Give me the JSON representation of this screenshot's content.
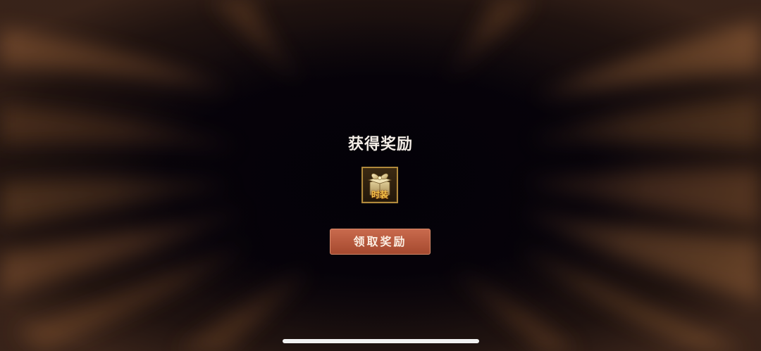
{
  "reward_popup": {
    "title": "获得奖励",
    "item": {
      "icon": "gift-box-icon",
      "tag": "时装"
    },
    "claim_button_label": "领取奖励"
  },
  "colors": {
    "background": "#06020a",
    "burst": "#8a5a36",
    "item_border": "#b18a3c",
    "button": "#b8583c",
    "title_text": "#f3ede6"
  }
}
